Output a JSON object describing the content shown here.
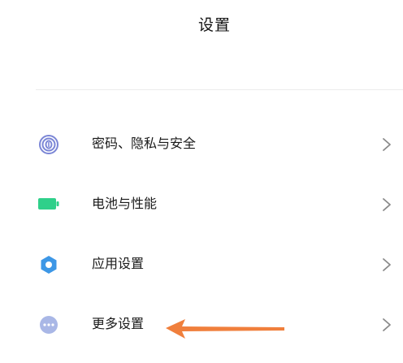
{
  "header": {
    "title": "设置"
  },
  "settings": {
    "items": [
      {
        "label": "密码、隐私与安全",
        "icon": "fingerprint-icon",
        "color": "#7b86d6"
      },
      {
        "label": "电池与性能",
        "icon": "battery-icon",
        "color": "#2fd08a"
      },
      {
        "label": "应用设置",
        "icon": "gear-icon",
        "color": "#3d97e6"
      },
      {
        "label": "更多设置",
        "icon": "more-icon",
        "color": "#a9b7e6"
      }
    ]
  },
  "annotation": {
    "arrow_color": "#f07f3c"
  }
}
